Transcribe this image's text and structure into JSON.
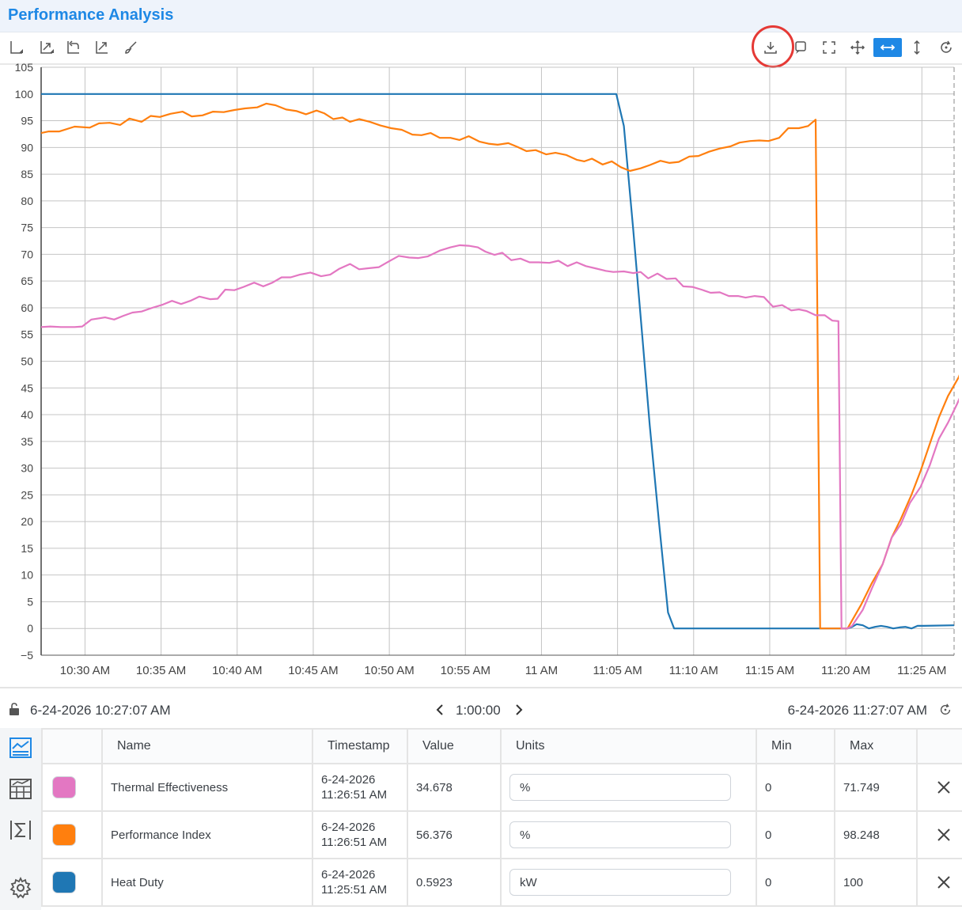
{
  "window": {
    "title": "Performance Analysis"
  },
  "toolbar": {
    "left_tools": [
      "axes-options-icon",
      "zoom-box-icon",
      "zoom-back-icon",
      "zoom-extents-icon",
      "paint-brush-icon"
    ],
    "right_tools": [
      "download-icon",
      "annotate-icon",
      "fullscreen-icon",
      "pan-icon",
      "horizontal-zoom-icon",
      "vertical-zoom-icon",
      "reset-icon"
    ],
    "active_tool": "horizontal-zoom-icon",
    "highlighted_tool": "download-icon"
  },
  "chart_data": {
    "type": "line",
    "title": "",
    "xlabel": "",
    "ylabel": "",
    "ylim": [
      -5,
      105
    ],
    "yticks": [
      "−5",
      "0",
      "5",
      "10",
      "15",
      "20",
      "25",
      "30",
      "35",
      "40",
      "45",
      "50",
      "55",
      "60",
      "65",
      "70",
      "75",
      "80",
      "85",
      "90",
      "95",
      "100",
      "105"
    ],
    "xlim": [
      "10:27:07 AM",
      "11:27:07 AM"
    ],
    "xtick_labels": [
      "10:30 AM",
      "10:35 AM",
      "10:40 AM",
      "10:45 AM",
      "10:50 AM",
      "10:55 AM",
      "11 AM",
      "11:05 AM",
      "11:10 AM",
      "11:15 AM",
      "11:20 AM",
      "11:25 AM"
    ],
    "grid": true,
    "series": [
      {
        "name": "Heat Duty",
        "color": "#1f77b4",
        "points": [
          [
            0,
            100
          ],
          [
            37.8,
            100
          ],
          [
            38.3,
            94
          ],
          [
            38.9,
            75
          ],
          [
            39.5,
            55
          ],
          [
            40,
            38
          ],
          [
            40.6,
            20
          ],
          [
            41.2,
            3
          ],
          [
            41.6,
            0
          ],
          [
            42,
            0
          ],
          [
            53,
            0
          ],
          [
            53.3,
            0.3
          ],
          [
            53.6,
            0.8
          ],
          [
            54,
            0.6
          ],
          [
            54.4,
            0
          ],
          [
            54.8,
            0.3
          ],
          [
            55.2,
            0.5
          ],
          [
            55.6,
            0.3
          ],
          [
            56,
            0
          ],
          [
            56.4,
            0.2
          ],
          [
            56.8,
            0.3
          ],
          [
            57.2,
            0
          ],
          [
            57.6,
            0.5
          ],
          [
            58,
            0.5
          ],
          [
            60,
            0.6
          ]
        ]
      },
      {
        "name": "Performance Index",
        "color": "#ff7f0e",
        "points": [
          [
            0,
            92.7
          ],
          [
            0.5,
            93
          ],
          [
            1.2,
            93
          ],
          [
            2.2,
            93.9
          ],
          [
            3.2,
            93.7
          ],
          [
            3.8,
            94.5
          ],
          [
            4.5,
            94.6
          ],
          [
            5.2,
            94.2
          ],
          [
            5.8,
            95.4
          ],
          [
            6.6,
            94.8
          ],
          [
            7.2,
            95.9
          ],
          [
            7.8,
            95.7
          ],
          [
            8.5,
            96.3
          ],
          [
            9.3,
            96.7
          ],
          [
            9.9,
            95.8
          ],
          [
            10.6,
            96
          ],
          [
            11.3,
            96.7
          ],
          [
            12,
            96.6
          ],
          [
            12.7,
            97
          ],
          [
            13.4,
            97.3
          ],
          [
            14.2,
            97.5
          ],
          [
            14.8,
            98.2
          ],
          [
            15.4,
            97.9
          ],
          [
            16.1,
            97.1
          ],
          [
            16.8,
            96.8
          ],
          [
            17.4,
            96.2
          ],
          [
            18.1,
            96.9
          ],
          [
            18.6,
            96.4
          ],
          [
            19.2,
            95.3
          ],
          [
            19.8,
            95.6
          ],
          [
            20.3,
            94.8
          ],
          [
            20.9,
            95.3
          ],
          [
            21.6,
            94.8
          ],
          [
            22.3,
            94.1
          ],
          [
            23,
            93.6
          ],
          [
            23.7,
            93.3
          ],
          [
            24.4,
            92.4
          ],
          [
            25,
            92.3
          ],
          [
            25.6,
            92.7
          ],
          [
            26.2,
            91.8
          ],
          [
            26.9,
            91.8
          ],
          [
            27.5,
            91.4
          ],
          [
            28.1,
            92.1
          ],
          [
            28.8,
            91.1
          ],
          [
            29.4,
            90.7
          ],
          [
            30,
            90.5
          ],
          [
            30.7,
            90.8
          ],
          [
            31.3,
            90.1
          ],
          [
            31.9,
            89.3
          ],
          [
            32.5,
            89.5
          ],
          [
            33.2,
            88.7
          ],
          [
            33.8,
            89
          ],
          [
            34.5,
            88.6
          ],
          [
            35.2,
            87.7
          ],
          [
            35.7,
            87.4
          ],
          [
            36.2,
            87.9
          ],
          [
            36.9,
            86.8
          ],
          [
            37.5,
            87.4
          ],
          [
            38.1,
            86.3
          ],
          [
            38.7,
            85.6
          ],
          [
            39.4,
            86.1
          ],
          [
            40,
            86.7
          ],
          [
            40.7,
            87.5
          ],
          [
            41.3,
            87.1
          ],
          [
            41.9,
            87.3
          ],
          [
            42.6,
            88.3
          ],
          [
            43.2,
            88.4
          ],
          [
            43.9,
            89.2
          ],
          [
            44.6,
            89.8
          ],
          [
            45.3,
            90.2
          ],
          [
            45.9,
            90.9
          ],
          [
            46.6,
            91.2
          ],
          [
            47.2,
            91.3
          ],
          [
            47.8,
            91.2
          ],
          [
            48.5,
            91.8
          ],
          [
            49.1,
            93.6
          ],
          [
            49.8,
            93.6
          ],
          [
            50.4,
            94
          ],
          [
            50.9,
            95.2
          ],
          [
            51.2,
            0
          ],
          [
            53,
            0
          ],
          [
            53.3,
            1.5
          ],
          [
            53.9,
            4.5
          ],
          [
            54.6,
            8.5
          ],
          [
            55.3,
            12
          ],
          [
            55.9,
            17
          ],
          [
            56.5,
            20.5
          ],
          [
            57.2,
            25
          ],
          [
            57.8,
            29.5
          ],
          [
            58.4,
            34.5
          ],
          [
            59,
            39.5
          ],
          [
            59.6,
            43.5
          ],
          [
            60.3,
            47
          ],
          [
            60.9,
            51.5
          ],
          [
            61.5,
            56
          ],
          [
            62,
            56.4
          ]
        ]
      },
      {
        "name": "Thermal Effectiveness",
        "color": "#e377c2",
        "points": [
          [
            0,
            56.4
          ],
          [
            0.6,
            56.5
          ],
          [
            1.3,
            56.4
          ],
          [
            2.2,
            56.4
          ],
          [
            2.7,
            56.5
          ],
          [
            3.3,
            57.8
          ],
          [
            4.2,
            58.2
          ],
          [
            4.8,
            57.8
          ],
          [
            5.4,
            58.5
          ],
          [
            6,
            59.1
          ],
          [
            6.6,
            59.3
          ],
          [
            7.3,
            60
          ],
          [
            8,
            60.6
          ],
          [
            8.6,
            61.3
          ],
          [
            9.2,
            60.7
          ],
          [
            9.8,
            61.3
          ],
          [
            10.4,
            62.1
          ],
          [
            11.1,
            61.6
          ],
          [
            11.6,
            61.7
          ],
          [
            12.1,
            63.4
          ],
          [
            12.7,
            63.3
          ],
          [
            13.3,
            63.9
          ],
          [
            14,
            64.7
          ],
          [
            14.6,
            64
          ],
          [
            15.2,
            64.7
          ],
          [
            15.8,
            65.7
          ],
          [
            16.4,
            65.7
          ],
          [
            17,
            66.2
          ],
          [
            17.7,
            66.6
          ],
          [
            18.4,
            65.9
          ],
          [
            19,
            66.2
          ],
          [
            19.6,
            67.3
          ],
          [
            20.3,
            68.2
          ],
          [
            20.9,
            67.2
          ],
          [
            21.5,
            67.4
          ],
          [
            22.2,
            67.6
          ],
          [
            22.8,
            68.6
          ],
          [
            23.5,
            69.7
          ],
          [
            24.2,
            69.4
          ],
          [
            24.8,
            69.3
          ],
          [
            25.4,
            69.6
          ],
          [
            26.2,
            70.7
          ],
          [
            26.9,
            71.3
          ],
          [
            27.5,
            71.7
          ],
          [
            28.1,
            71.6
          ],
          [
            28.7,
            71.3
          ],
          [
            29.2,
            70.5
          ],
          [
            29.8,
            69.9
          ],
          [
            30.3,
            70.3
          ],
          [
            30.9,
            68.9
          ],
          [
            31.5,
            69.2
          ],
          [
            32.1,
            68.5
          ],
          [
            32.7,
            68.5
          ],
          [
            33.4,
            68.4
          ],
          [
            34,
            68.8
          ],
          [
            34.6,
            67.8
          ],
          [
            35.2,
            68.5
          ],
          [
            35.8,
            67.8
          ],
          [
            36.4,
            67.4
          ],
          [
            37.1,
            66.9
          ],
          [
            37.6,
            66.7
          ],
          [
            38.3,
            66.8
          ],
          [
            38.9,
            66.5
          ],
          [
            39.4,
            66.7
          ],
          [
            39.9,
            65.5
          ],
          [
            40.5,
            66.4
          ],
          [
            41.1,
            65.4
          ],
          [
            41.7,
            65.5
          ],
          [
            42.2,
            64
          ],
          [
            42.8,
            63.9
          ],
          [
            43.4,
            63.4
          ],
          [
            44,
            62.8
          ],
          [
            44.6,
            62.9
          ],
          [
            45.2,
            62.2
          ],
          [
            45.8,
            62.2
          ],
          [
            46.3,
            61.9
          ],
          [
            46.9,
            62.2
          ],
          [
            47.5,
            62
          ],
          [
            48.1,
            60.2
          ],
          [
            48.7,
            60.5
          ],
          [
            49.3,
            59.5
          ],
          [
            49.8,
            59.7
          ],
          [
            50.3,
            59.4
          ],
          [
            50.9,
            58.6
          ],
          [
            51.5,
            58.6
          ],
          [
            52,
            57.6
          ],
          [
            52.4,
            57.5
          ],
          [
            52.6,
            0
          ],
          [
            53,
            0
          ],
          [
            53.3,
            0.5
          ],
          [
            54,
            3.5
          ],
          [
            54.6,
            7.5
          ],
          [
            55.3,
            12
          ],
          [
            55.9,
            17
          ],
          [
            56.5,
            19.5
          ],
          [
            57.1,
            23.5
          ],
          [
            57.8,
            26.5
          ],
          [
            58.4,
            30.5
          ],
          [
            59,
            35.5
          ],
          [
            59.6,
            38.5
          ],
          [
            60.2,
            42
          ],
          [
            60.8,
            46
          ],
          [
            61.4,
            50.5
          ],
          [
            61.9,
            54
          ],
          [
            62.2,
            56.4
          ]
        ]
      }
    ]
  },
  "range": {
    "start": "6-24-2026 10:27:07 AM",
    "duration": "1:00:00",
    "end": "6-24-2026 11:27:07 AM"
  },
  "side_tabs": [
    "trend-view-icon",
    "table-view-icon",
    "statistics-icon",
    "settings-icon"
  ],
  "table": {
    "headers": {
      "color": "",
      "name": "Name",
      "timestamp": "Timestamp",
      "value": "Value",
      "units": "Units",
      "min": "Min",
      "max": "Max"
    },
    "rows": [
      {
        "name": "Thermal Effectiveness",
        "color": "#e377c2",
        "ts_date": "6-24-2026",
        "ts_time": "11:26:51 AM",
        "value": "34.678",
        "units": "%",
        "min": "0",
        "max": "71.749"
      },
      {
        "name": "Performance Index",
        "color": "#ff7f0e",
        "ts_date": "6-24-2026",
        "ts_time": "11:26:51 AM",
        "value": "56.376",
        "units": "%",
        "min": "0",
        "max": "98.248"
      },
      {
        "name": "Heat Duty",
        "color": "#1f77b4",
        "ts_date": "6-24-2026",
        "ts_time": "11:25:51 AM",
        "value": "0.5923",
        "units": "kW",
        "min": "0",
        "max": "100"
      }
    ]
  }
}
